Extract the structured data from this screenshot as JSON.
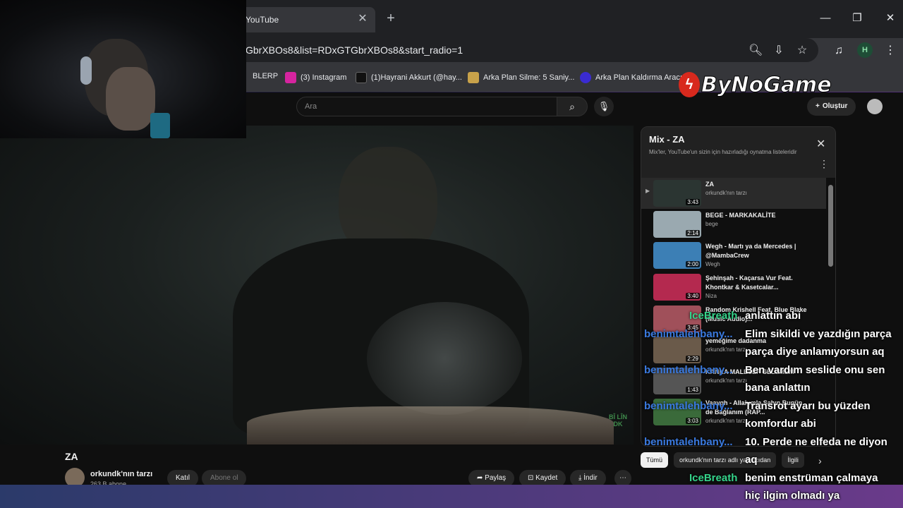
{
  "browser": {
    "tab_title": "YouTube",
    "tab_close": "✕",
    "new_tab": "+",
    "url": "GbrXBOs8&list=RDxGTGbrXBOs8&start_radio=1",
    "profile_initial": "H",
    "bookmarks": [
      {
        "label": "BLERP",
        "color": "#444"
      },
      {
        "label": "(3) Instagram",
        "color": "#d6249f"
      },
      {
        "label": "(1)Hayrani Akkurt (@hay...",
        "color": "#111"
      },
      {
        "label": "Arka Plan Silme: 5 Saniy...",
        "color": "#c8a24a"
      },
      {
        "label": "Arka Plan Kaldırma Aracı...",
        "color": "#3a2bd1"
      }
    ]
  },
  "youtube": {
    "search_placeholder": "Ara",
    "create_label": "Oluştur",
    "video_title": "ZA",
    "watermark": "BÎ LÎN DK",
    "channel_name": "orkundk'nın tarzı",
    "subscribers": "263 B abone",
    "join_label": "Katıl",
    "subscribe_label": "Abone ol",
    "actions": {
      "share": "Paylaş",
      "save": "Kaydet",
      "download": "İndir"
    },
    "playlist": {
      "title": "Mix - ZA",
      "subtitle": "Mix'ler, YouTube'un sizin için hazırladığı oynatma listeleridir",
      "items": [
        {
          "title": "ZA",
          "artist": "orkundk'nın tarzı",
          "duration": "3:43",
          "color": "#2b3532"
        },
        {
          "title": "BEGE - MARKAKALİTE",
          "artist": "bege",
          "duration": "2:14",
          "color": "#9aa9b0"
        },
        {
          "title": "Wegh - Martı ya da Mercedes | @MambaCrew",
          "artist": "Wegh",
          "duration": "2:00",
          "color": "#3c7fb5"
        },
        {
          "title": "Şehinşah - Kaçarsa Vur Feat. Khontkar & Kasetcalar...",
          "artist": "Niza",
          "duration": "3:40",
          "color": "#b4294f"
        },
        {
          "title": "Random Krishell Feat. Blue Blake (Music Audio)...",
          "artist": "",
          "duration": "3:45",
          "color": "#a0505a"
        },
        {
          "title": "yemeğime dadanma",
          "artist": "orkundk'nın tarzı",
          "duration": "2:29",
          "color": "#6a5a4a"
        },
        {
          "title": "KANKA MALESEF GELEMEM",
          "artist": "orkundk'nın tarzı",
          "duration": "1:43",
          "color": "#555"
        },
        {
          "title": "Vaaygh - Allahımla Şahın Bugün de Bağlanım (RAP...",
          "artist": "orkundk'nın tarzı",
          "duration": "3:03",
          "color": "#3a6a3a"
        }
      ]
    },
    "chips": [
      "Tümü",
      "orkundk'nın tarzı adlı yayıncıdan",
      "İlgili"
    ]
  },
  "overlay": {
    "logo_text": "ByNoGame",
    "chat": [
      {
        "user": "IceBreath",
        "user_color": "#35d48a",
        "lines": [
          "anlattın abi"
        ]
      },
      {
        "user": "benimtalehbany...",
        "user_color": "#3a7ae0",
        "lines": [
          "Elim sikildi ve yazdığın parça",
          "parça diye anlamıyorsun aq"
        ]
      },
      {
        "user": "benimtalehbany...",
        "user_color": "#3a7ae0",
        "lines": [
          "Ben vardım seslide onu sen",
          "bana anlattın"
        ]
      },
      {
        "user": "benimtalehbany...",
        "user_color": "#3a7ae0",
        "lines": [
          "Transrot ayarı bu yüzden",
          "komfordur abi"
        ]
      },
      {
        "user": "benimtalehbany...",
        "user_color": "#3a7ae0",
        "lines": [
          "10. Perde ne elfeda ne diyon",
          "aq"
        ]
      },
      {
        "user": "IceBreath",
        "user_color": "#35d48a",
        "lines": [
          "benim enstrüman çalmaya",
          "hiç ilgim olmadı ya"
        ]
      }
    ]
  }
}
